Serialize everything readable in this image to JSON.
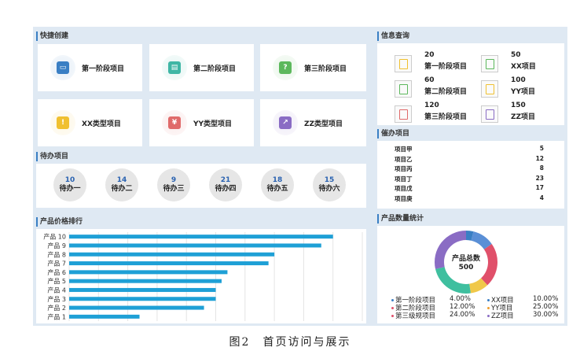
{
  "quick_create": {
    "title": "快捷创建",
    "items": [
      {
        "label": "第一阶段项目",
        "icon": "browser-icon",
        "color": "#3a7fc4"
      },
      {
        "label": "第二阶段项目",
        "icon": "folder-icon",
        "color": "#3fb6a5"
      },
      {
        "label": "第三阶段项目",
        "icon": "document-icon",
        "color": "#5cb85c"
      },
      {
        "label": "XX类型项目",
        "icon": "alert-doc-icon",
        "color": "#f0c030"
      },
      {
        "label": "YY类型项目",
        "icon": "money-icon",
        "color": "#e06a6a"
      },
      {
        "label": "ZZ类型项目",
        "icon": "chart-icon",
        "color": "#8a6cc4"
      }
    ]
  },
  "todo": {
    "title": "待办项目",
    "items": [
      {
        "count": "10",
        "label": "待办一"
      },
      {
        "count": "14",
        "label": "待办二"
      },
      {
        "count": "9",
        "label": "待办三"
      },
      {
        "count": "21",
        "label": "待办四"
      },
      {
        "count": "18",
        "label": "待办五"
      },
      {
        "count": "15",
        "label": "待办六"
      }
    ]
  },
  "price_rank": {
    "title": "产品价格排行",
    "chart_data": {
      "type": "bar",
      "orientation": "horizontal",
      "categories": [
        "产品 10",
        "产品 9",
        "产品 8",
        "产品 7",
        "产品 6",
        "产品 5",
        "产品 4",
        "产品 3",
        "产品 2",
        "产品 1"
      ],
      "values": [
        90,
        86,
        70,
        68,
        54,
        52,
        50,
        50,
        46,
        24
      ],
      "xlim": [
        0,
        100
      ],
      "grid": true
    }
  },
  "info_query": {
    "title": "信息查询",
    "items": [
      {
        "num": "20",
        "name": "第一阶段项目",
        "icon": "doc-icon",
        "color": "#f0c030"
      },
      {
        "num": "50",
        "name": "XX项目",
        "icon": "doc-icon",
        "color": "#5cb85c"
      },
      {
        "num": "60",
        "name": "第二阶段项目",
        "icon": "doc-icon",
        "color": "#5cb85c"
      },
      {
        "num": "100",
        "name": "YY项目",
        "icon": "doc-icon",
        "color": "#f0c030"
      },
      {
        "num": "120",
        "name": "第三阶段项目",
        "icon": "doc-icon",
        "color": "#e06a6a"
      },
      {
        "num": "150",
        "name": "ZZ项目",
        "icon": "doc-icon",
        "color": "#8a6cc4"
      }
    ]
  },
  "urge": {
    "title": "催办项目",
    "items": [
      {
        "name": "项目甲",
        "value": "5"
      },
      {
        "name": "项目乙",
        "value": "12"
      },
      {
        "name": "项目丙",
        "value": "8"
      },
      {
        "name": "项目丁",
        "value": "23"
      },
      {
        "name": "项目戊",
        "value": "17"
      },
      {
        "name": "项目庚",
        "value": "4"
      }
    ]
  },
  "product_stats": {
    "title": "产品数量统计",
    "center_label": "产品总数",
    "center_value": "500",
    "chart_data": {
      "type": "pie",
      "donut": true,
      "labels": [
        "第一阶段项目",
        "第二阶段项目",
        "第三级规项目",
        "XX项目",
        "YY项目",
        "ZZ项目"
      ],
      "values": [
        4.0,
        12.0,
        24.0,
        10.0,
        25.0,
        30.0
      ],
      "colors": [
        "#3a7fc4",
        "#e0506a",
        "#e04e6a",
        "#f0c84a",
        "#f0c84a",
        "#8a6cc4"
      ]
    },
    "legend": [
      {
        "name": "第一阶段项目",
        "pct": "4.00%",
        "color": "#3a7fc4"
      },
      {
        "name": "第二阶段项目",
        "pct": "12.00%",
        "color": "#e0506a"
      },
      {
        "name": "第三级规项目",
        "pct": "24.00%",
        "color": "#e04e6a"
      },
      {
        "name": "XX项目",
        "pct": "10.00%",
        "color": "#3a7fc4"
      },
      {
        "name": "YY项目",
        "pct": "25.00%",
        "color": "#f0a030"
      },
      {
        "name": "ZZ项目",
        "pct": "30.00%",
        "color": "#8a6cc4"
      }
    ]
  },
  "caption": "图2　首页访问与展示"
}
